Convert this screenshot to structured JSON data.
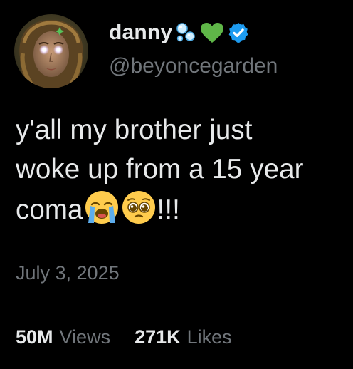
{
  "user": {
    "display_name": "danny",
    "handle": "@beyoncegarden",
    "name_emojis": [
      "bubbles-icon",
      "green-heart-icon"
    ],
    "verified_badge_icon": "verified-badge-icon",
    "verified_color": "#1d9bf0",
    "avatar_icon": "avatar-portrait"
  },
  "tweet": {
    "lines": [
      "y'all my brother just",
      "woke up from a 15 year"
    ],
    "last_line_start": "coma",
    "last_line_emojis": [
      "loudly-crying-face-icon",
      "pleading-face-icon"
    ],
    "last_line_end": "!!!",
    "date": "July 3, 2025"
  },
  "stats": {
    "views_count": "50M",
    "views_label": "Views",
    "likes_count": "271K",
    "likes_label": "Likes"
  },
  "colors": {
    "background": "#000000",
    "text_primary": "#e7e9ea",
    "text_secondary": "#71767b"
  }
}
